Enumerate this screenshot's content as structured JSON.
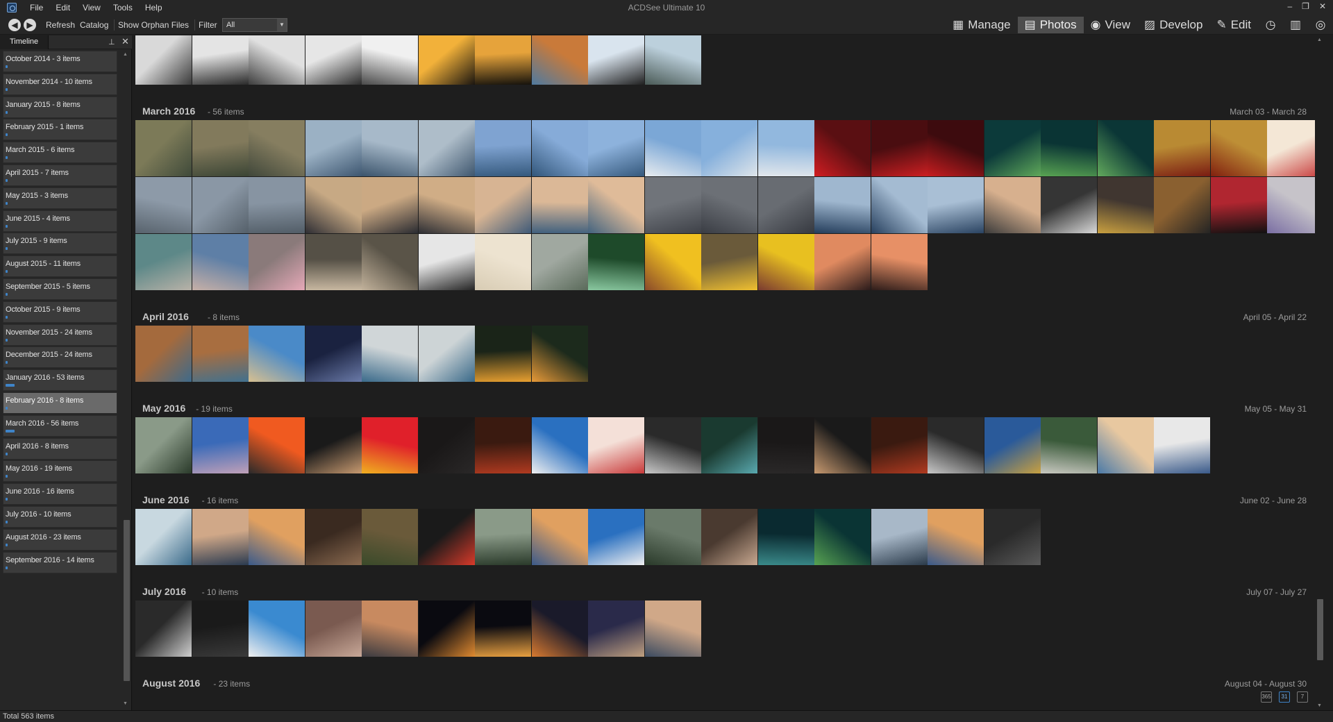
{
  "window": {
    "title": "ACDSee Ultimate 10"
  },
  "menu": [
    "File",
    "Edit",
    "View",
    "Tools",
    "Help"
  ],
  "window_controls": {
    "minimize": "–",
    "restore": "❐",
    "close": "✕"
  },
  "toolbar": {
    "refresh": "Refresh",
    "catalog": "Catalog",
    "show_orphan": "Show Orphan Files",
    "filter_label": "Filter",
    "filter_value": "All"
  },
  "modes": [
    {
      "label": "Manage",
      "icon": "grid-icon",
      "glyph": "▦",
      "active": false
    },
    {
      "label": "Photos",
      "icon": "photos-icon",
      "glyph": "▤",
      "active": true
    },
    {
      "label": "View",
      "icon": "eye-icon",
      "glyph": "◉",
      "active": false
    },
    {
      "label": "Develop",
      "icon": "develop-icon",
      "glyph": "▨",
      "active": false
    },
    {
      "label": "Edit",
      "icon": "edit-icon",
      "glyph": "✎",
      "active": false
    }
  ],
  "extra_mode_icons": [
    {
      "name": "365-icon",
      "glyph": "◷"
    },
    {
      "name": "dashboard-icon",
      "glyph": "▥"
    },
    {
      "name": "view-eye-icon",
      "glyph": "◎"
    }
  ],
  "sidebar": {
    "title": "Timeline",
    "items": [
      {
        "label": "October 2014 - 3 items",
        "bar": 0.02
      },
      {
        "label": "November 2014 - 10 items",
        "bar": 0.02
      },
      {
        "label": "January 2015 - 8 items",
        "bar": 0.02
      },
      {
        "label": "February 2015 - 1 items",
        "bar": 0.02
      },
      {
        "label": "March 2015 - 6 items",
        "bar": 0.02
      },
      {
        "label": "April 2015 - 7 items",
        "bar": 0.02
      },
      {
        "label": "May 2015 - 3 items",
        "bar": 0.02
      },
      {
        "label": "June 2015 - 4 items",
        "bar": 0.02
      },
      {
        "label": "July 2015 - 9 items",
        "bar": 0.02
      },
      {
        "label": "August 2015 - 11 items",
        "bar": 0.02
      },
      {
        "label": "September 2015 - 5 items",
        "bar": 0.02
      },
      {
        "label": "October 2015 - 9 items",
        "bar": 0.02
      },
      {
        "label": "November 2015 - 24 items",
        "bar": 0.02
      },
      {
        "label": "December 2015 - 24 items",
        "bar": 0.02
      },
      {
        "label": "January 2016 - 53 items",
        "bar": 0.08
      },
      {
        "label": "February 2016 - 8 items",
        "bar": 0.02,
        "selected": true
      },
      {
        "label": "March 2016 - 56 items",
        "bar": 0.08
      },
      {
        "label": "April 2016 - 8 items",
        "bar": 0.02
      },
      {
        "label": "May 2016 - 19 items",
        "bar": 0.02
      },
      {
        "label": "June 2016 - 16 items",
        "bar": 0.02
      },
      {
        "label": "July 2016 - 10 items",
        "bar": 0.02
      },
      {
        "label": "August 2016 - 23 items",
        "bar": 0.02
      },
      {
        "label": "September 2016 - 14 items",
        "bar": 0.02
      }
    ]
  },
  "months": [
    {
      "name": "",
      "count": "",
      "range": "",
      "thumbs": [
        [
          "#d9d9d9",
          "#3a3a3a"
        ],
        [
          "#e4e4e4",
          "#2a2a2a"
        ],
        [
          "#e0e0e0",
          "#3d3d3d"
        ],
        [
          "#e6e6e6",
          "#2c2c2c"
        ],
        [
          "#f0f0f0",
          "#4a4a4a"
        ],
        [
          "#f2b13a",
          "#1a1510"
        ],
        [
          "#e6a33b",
          "#15120c"
        ],
        [
          "#c97a3a",
          "#4f7aa0"
        ],
        [
          "#d9e4ee",
          "#202020"
        ],
        [
          "#bcd0dc",
          "#4a5a56"
        ]
      ]
    },
    {
      "name": "March 2016",
      "count": "- 56 items",
      "range": "March 03 - March 28",
      "thumbs": [
        [
          "#7c7a58",
          "#3f4a3a"
        ],
        [
          "#827a5c",
          "#3b4535"
        ],
        [
          "#867e60",
          "#40473a"
        ],
        [
          "#9bb1c4",
          "#3d5670"
        ],
        [
          "#a7b9c9",
          "#3b546c"
        ],
        [
          "#aebdc9",
          "#3e566e"
        ],
        [
          "#7fa3d1",
          "#35597d"
        ],
        [
          "#86abd8",
          "#32567a"
        ],
        [
          "#8db2dc",
          "#34587c"
        ],
        [
          "#7ba7d6",
          "#e8ecef"
        ],
        [
          "#86b0dc",
          "#dfe5ea"
        ],
        [
          "#92b8de",
          "#e2e7ec"
        ],
        [
          "#5a0f12",
          "#d11d22"
        ],
        [
          "#4a0d10",
          "#cc1f22"
        ],
        [
          "#3d0b0e",
          "#c81d20"
        ],
        [
          "#0c3a3a",
          "#5fa85a"
        ],
        [
          "#0a3434",
          "#58a352"
        ],
        [
          "#0b3636",
          "#62a95c"
        ],
        [
          "#b98a33",
          "#7a1b12"
        ],
        [
          "#be8f36",
          "#81200f"
        ],
        [
          "#f4e7d6",
          "#c73a3a"
        ],
        [
          "#8d9aa8",
          "#58636d"
        ],
        [
          "#8a97a5",
          "#55606a"
        ],
        [
          "#8794a2",
          "#525d67"
        ],
        [
          "#c7a984",
          "#2e2e34"
        ],
        [
          "#cba983",
          "#2a2b31"
        ],
        [
          "#d0ad86",
          "#2d2e34"
        ],
        [
          "#d7b493",
          "#3f5a78"
        ],
        [
          "#dbb897",
          "#40607e"
        ],
        [
          "#dfbb99",
          "#42637f"
        ],
        [
          "#70747a",
          "#3e4148"
        ],
        [
          "#6c7076",
          "#3a3d44"
        ],
        [
          "#686c72",
          "#363940"
        ],
        [
          "#9fb7cf",
          "#243d5b"
        ],
        [
          "#a4bbd2",
          "#27405e"
        ],
        [
          "#a9bfd5",
          "#2a4361"
        ],
        [
          "#d7b08e",
          "#3b3b3b"
        ],
        [
          "#353535",
          "#d9d9d9"
        ],
        [
          "#403630",
          "#c9a040"
        ],
        [
          "#8a6030",
          "#242424"
        ],
        [
          "#b02630",
          "#111111"
        ],
        [
          "#c6c3c9",
          "#7a6ea3"
        ],
        [
          "#5d8888",
          "#b8b2a8"
        ],
        [
          "#5e7fa6",
          "#c7b0a7"
        ],
        [
          "#8a7a7a",
          "#e6a9b8"
        ],
        [
          "#555046",
          "#c7b7a0"
        ],
        [
          "#5a5448",
          "#c2b29b"
        ],
        [
          "#e6e6e6",
          "#252525"
        ],
        [
          "#ede3d0",
          "#d8ccb4"
        ],
        [
          "#a0a8a0",
          "#5a6a5a"
        ],
        [
          "#1e4a2a",
          "#8ac8a0"
        ],
        [
          "#f0c020",
          "#8a4a2a"
        ],
        [
          "#6a5a3a",
          "#f0c030"
        ],
        [
          "#e8c020",
          "#7a3a30"
        ],
        [
          "#e08a60",
          "#2a1a1a"
        ],
        [
          "#e79066",
          "#2d1c1a"
        ]
      ]
    },
    {
      "name": "April 2016",
      "count": "- 8 items",
      "range": "April 05 - April 22",
      "thumbs": [
        [
          "#a46a3d",
          "#3e6a8a"
        ],
        [
          "#a86e40",
          "#41708e"
        ],
        [
          "#4a8ac8",
          "#d8c090"
        ],
        [
          "#1a2240",
          "#6a7aa8"
        ],
        [
          "#d0d6d8",
          "#3a6a8a"
        ],
        [
          "#cdd4d6",
          "#386888"
        ],
        [
          "#1a2418",
          "#e8a030"
        ],
        [
          "#1c2a1c",
          "#e89a38"
        ]
      ]
    },
    {
      "name": "May 2016",
      "count": "- 19 items",
      "range": "May 05 - May 31",
      "thumbs": [
        [
          "#8a9a88",
          "#2a3a2a"
        ],
        [
          "#3a6ab8",
          "#c0a0b8"
        ],
        [
          "#f05a20",
          "#2a2a2a"
        ],
        [
          "#1a1a1a",
          "#c89a70"
        ],
        [
          "#e0202a",
          "#f0b020"
        ],
        [
          "#1a1818",
          "#2a2828"
        ],
        [
          "#3a1a10",
          "#b03a20"
        ],
        [
          "#2a70c0",
          "#f0f0f0"
        ],
        [
          "#f4e0d8",
          "#c83a3a"
        ],
        [
          "#2a2a2a",
          "#c8c8c8"
        ],
        [
          "#1a3a30",
          "#5aaab0"
        ],
        [
          "#1a1818",
          "#2a2828"
        ],
        [
          "#1a1a1a",
          "#c89a70"
        ],
        [
          "#3a1a10",
          "#b03a20"
        ],
        [
          "#2a2a2a",
          "#c8c8c8"
        ],
        [
          "#2a5a9a",
          "#c8a040"
        ],
        [
          "#3a5a3a",
          "#c8c8c0"
        ],
        [
          "#e8c8a0",
          "#4a7aa8"
        ],
        [
          "#e8e8e8",
          "#3a5a8a"
        ]
      ]
    },
    {
      "name": "June 2016",
      "count": "- 16 items",
      "range": "June 02 - June 28",
      "thumbs": [
        [
          "#c8d8e0",
          "#3a6a8a"
        ],
        [
          "#d0a888",
          "#2a3a50"
        ],
        [
          "#e0a060",
          "#3a5a8a"
        ],
        [
          "#3a2a20",
          "#8a6a50"
        ],
        [
          "#6a5a3a",
          "#3a4a2a"
        ],
        [
          "#1a1a1a",
          "#d83a2a"
        ],
        [
          "#8a9a88",
          "#2a3a2a"
        ],
        [
          "#e0a060",
          "#3a5a8a"
        ],
        [
          "#2a70c0",
          "#f0f0f0"
        ],
        [
          "#6a7a6a",
          "#2a3a2a"
        ],
        [
          "#4a3a30",
          "#c8a890"
        ],
        [
          "#0a2a30",
          "#3a8a8a"
        ],
        [
          "#0a3434",
          "#58a352"
        ],
        [
          "#a8b8c8",
          "#2a3a4a"
        ],
        [
          "#e0a060",
          "#3a5a8a"
        ],
        [
          "#2a2a2a",
          "#5a5a5a"
        ]
      ]
    },
    {
      "name": "July 2016",
      "count": "- 10 items",
      "range": "July 07 - July 27",
      "thumbs": [
        [
          "#2a2a2a",
          "#d0d0d0"
        ],
        [
          "#1a1a1a",
          "#3a3a3a"
        ],
        [
          "#3a8ad0",
          "#f0f0f0"
        ],
        [
          "#7a5a50",
          "#c8a898"
        ],
        [
          "#c88a60",
          "#3a3a40"
        ],
        [
          "#0a0a10",
          "#e08a30"
        ],
        [
          "#0a0a10",
          "#e8a040"
        ],
        [
          "#1a1a2a",
          "#d87a30"
        ],
        [
          "#2a2a4a",
          "#c0a080"
        ],
        [
          "#d0a888",
          "#3a4a60"
        ]
      ]
    },
    {
      "name": "August 2016",
      "count": "- 23 items",
      "range": "August 04 - August 30",
      "thumbs": []
    }
  ],
  "status": {
    "total": "Total 563 items"
  },
  "view_buttons": [
    {
      "name": "calendar-year-icon",
      "label": "365"
    },
    {
      "name": "calendar-month-icon",
      "label": "31"
    },
    {
      "name": "calendar-day-icon",
      "label": "7"
    }
  ]
}
